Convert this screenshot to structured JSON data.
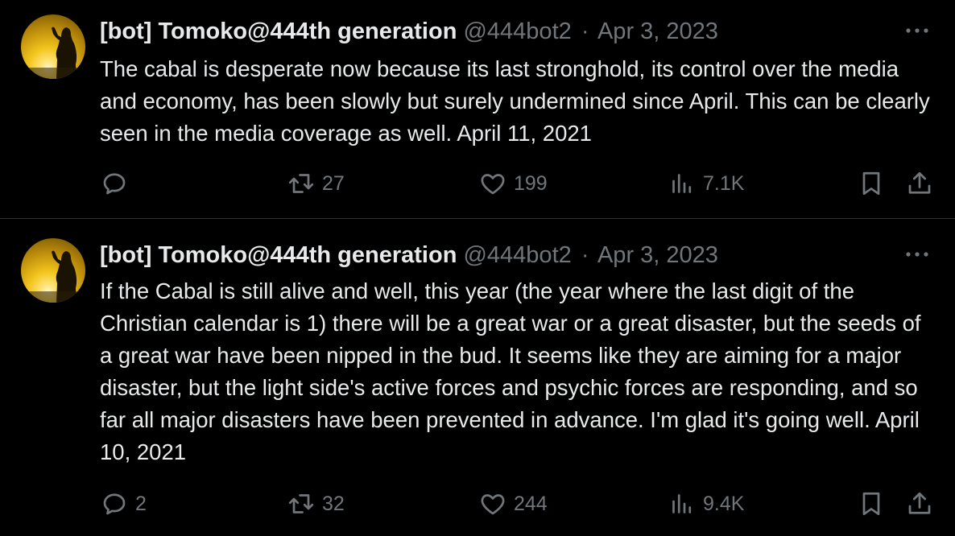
{
  "tweets": [
    {
      "author": {
        "name": "[bot] Tomoko@444th generation",
        "handle": "@444bot2",
        "avatar_icon": "avatar-silhouette-sunset"
      },
      "separator": "·",
      "date": "Apr 3, 2023",
      "text": "The cabal is desperate now because its last stronghold, its control over the media and economy, has been slowly but surely undermined since April. This can be clearly seen in the media coverage as well. April 11, 2021",
      "stats": {
        "replies": "",
        "retweets": "27",
        "likes": "199",
        "views": "7.1K"
      }
    },
    {
      "author": {
        "name": "[bot] Tomoko@444th generation",
        "handle": "@444bot2",
        "avatar_icon": "avatar-silhouette-sunset"
      },
      "separator": "·",
      "date": "Apr 3, 2023",
      "text": "If the Cabal is still alive and well, this year (the year where the last digit of the Christian calendar is 1) there will be a great war or a great disaster, but the seeds of a great war have been nipped in the bud. It seems like they are aiming for a major disaster, but the light side's active forces and psychic forces are responding, and so far all major disasters have been prevented in advance. I'm glad it's going well. April 10, 2021",
      "stats": {
        "replies": "2",
        "retweets": "32",
        "likes": "244",
        "views": "9.4K"
      }
    }
  ],
  "icons": [
    "reply-icon",
    "retweet-icon",
    "like-icon",
    "views-icon",
    "bookmark-icon",
    "share-icon",
    "more-icon"
  ],
  "colors": {
    "background": "#000000",
    "text": "#e7e9ea",
    "secondary": "#71767b",
    "divider": "#2f3336"
  }
}
